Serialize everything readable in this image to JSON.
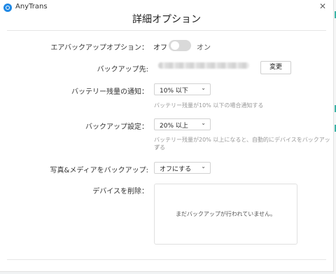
{
  "window": {
    "app_name": "AnyTrans",
    "close_glyph": "✕"
  },
  "page": {
    "title": "詳細オプション"
  },
  "airbackup": {
    "label": "エアバックアップオプション：",
    "off_text": "オフ",
    "on_text": "オン",
    "enabled": false
  },
  "backup_destination": {
    "label": "バックアップ先:",
    "change_button": "変更"
  },
  "battery_notification": {
    "label": "バッテリー残量の通知：",
    "selected": "10% 以下",
    "hint": "バッテリー残量が10% 以下の場合通知する"
  },
  "backup_setting": {
    "label": "バックアップ設定：",
    "selected": "20% 以上",
    "hint_line1": "バッテリー残量が20% 以上になると、自動的にデバイスをバックアップ",
    "hint_line2": "する"
  },
  "photo_media": {
    "label": "写真&メディアをバックアップ:",
    "selected": "オフにする"
  },
  "delete_device": {
    "label": "デバイスを削除：",
    "empty_message": "まだバックアップが行われていません。"
  },
  "icons": {
    "chevron": "⌄"
  }
}
